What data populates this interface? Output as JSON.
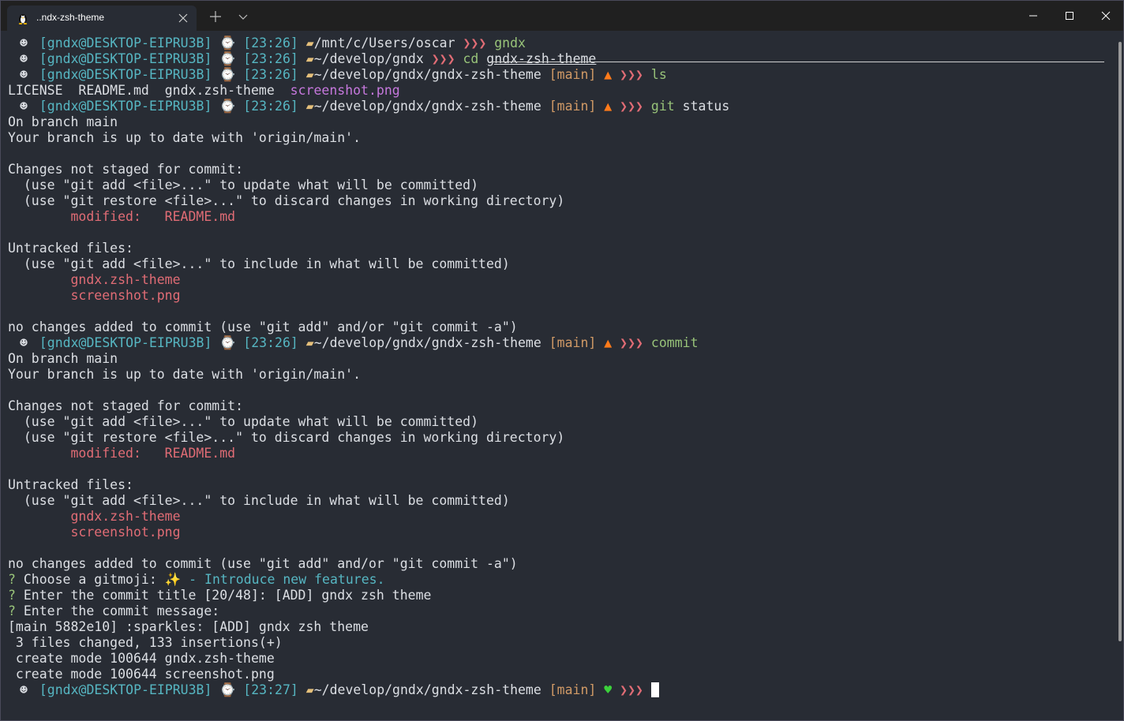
{
  "window": {
    "tab_title": "..ndx-zsh-theme",
    "tab_icon": "linux-penguin-icon",
    "new_tab_icon": "plus-icon",
    "dropdown_icon": "chevron-down-icon",
    "minimize_icon": "minimize-icon",
    "maximize_icon": "maximize-icon",
    "close_icon": "close-icon"
  },
  "colors": {
    "background": "#282c34",
    "text": "#dcdfe4",
    "cyan": "#56b6c2",
    "green": "#98c379",
    "red": "#e06c75",
    "magenta": "#c678dd",
    "orange": "#d19a66",
    "yellow": "#e5c07b"
  },
  "prompt": {
    "user_host": "[gndx@DESKTOP-EIPRU3B]",
    "arrows": "❯❯❯"
  },
  "terminal": {
    "p1_time": "[23:26]",
    "p1_path": "/mnt/c/Users/oscar",
    "p1_cmd": "gndx",
    "p2_time": "[23:26]",
    "p2_path": "~/develop/gndx",
    "p2_cmd": "cd",
    "p2_arg": "gndx-zsh-theme",
    "p3_time": "[23:26]",
    "p3_path": "~/develop/gndx/gndx-zsh-theme",
    "p3_branch": "[main]",
    "p3_cmd": "ls",
    "ls_1": "LICENSE",
    "ls_2": "README.md",
    "ls_3": "gndx.zsh-theme",
    "ls_4": "screenshot.png",
    "p4_time": "[23:26]",
    "p4_path": "~/develop/gndx/gndx-zsh-theme",
    "p4_branch": "[main]",
    "p4_cmd": "git",
    "p4_arg": "status",
    "s1_branch": "On branch main",
    "s1_uptodate": "Your branch is up to date with 'origin/main'.",
    "s1_changes": "Changes not staged for commit:",
    "s1_hint1": "  (use \"git add <file>...\" to update what will be committed)",
    "s1_hint2": "  (use \"git restore <file>...\" to discard changes in working directory)",
    "s1_modified": "        modified:   README.md",
    "s1_untracked": "Untracked files:",
    "s1_hint3": "  (use \"git add <file>...\" to include in what will be committed)",
    "s1_file1": "        gndx.zsh-theme",
    "s1_file2": "        screenshot.png",
    "s1_nochanges": "no changes added to commit (use \"git add\" and/or \"git commit -a\")",
    "p5_time": "[23:26]",
    "p5_path": "~/develop/gndx/gndx-zsh-theme",
    "p5_branch": "[main]",
    "p5_cmd": "commit",
    "s2_branch": "On branch main",
    "s2_uptodate": "Your branch is up to date with 'origin/main'.",
    "s2_changes": "Changes not staged for commit:",
    "s2_hint1": "  (use \"git add <file>...\" to update what will be committed)",
    "s2_hint2": "  (use \"git restore <file>...\" to discard changes in working directory)",
    "s2_modified": "        modified:   README.md",
    "s2_untracked": "Untracked files:",
    "s2_hint3": "  (use \"git add <file>...\" to include in what will be committed)",
    "s2_file1": "        gndx.zsh-theme",
    "s2_file2": "        screenshot.png",
    "s2_nochanges": "no changes added to commit (use \"git add\" and/or \"git commit -a\")",
    "q1_mark": "?",
    "q1_text": " Choose a gitmoji: ",
    "q1_emoji": "✨",
    "q1_answer": " - Introduce new features.",
    "q2_mark": "?",
    "q2_text": " Enter the commit title [20/48]: [ADD] gndx zsh theme",
    "q3_mark": "?",
    "q3_text": " Enter the commit message:",
    "r1": "[main 5882e10] :sparkles: [ADD] gndx zsh theme",
    "r2": " 3 files changed, 133 insertions(+)",
    "r3": " create mode 100644 gndx.zsh-theme",
    "r4": " create mode 100644 screenshot.png",
    "p6_time": "[23:27]",
    "p6_path": "~/develop/gndx/gndx-zsh-theme",
    "p6_branch": "[main]"
  }
}
